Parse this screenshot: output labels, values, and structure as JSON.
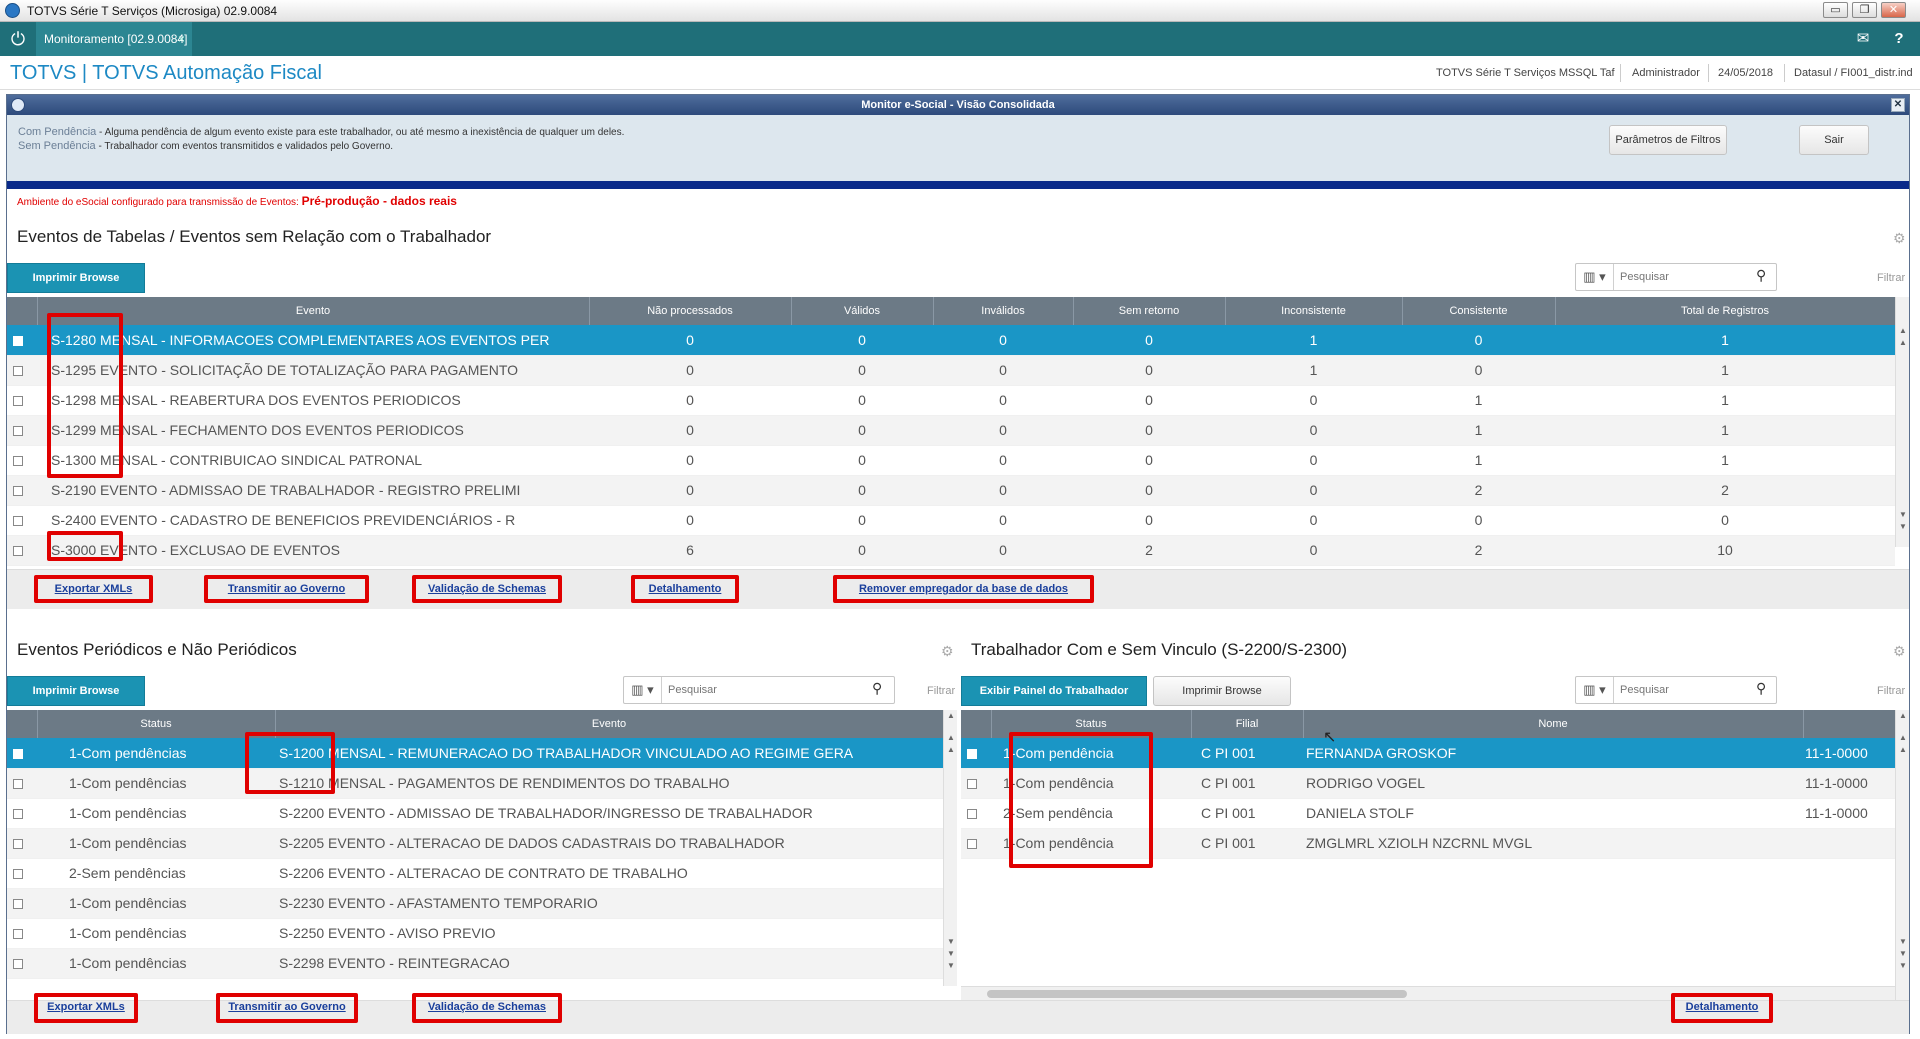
{
  "window": {
    "title": "TOTVS Série T Serviços (Microsiga) 02.9.0084",
    "min": "▭",
    "restore": "❐",
    "close": "✕"
  },
  "tab": {
    "label": "Monitoramento [02.9.0084]",
    "close": "×",
    "home_icon": "power-icon",
    "mail_icon": "✉",
    "help_icon": "?"
  },
  "header": {
    "brand": "TOTVS | TOTVS Automação Fiscal",
    "system": "TOTVS Série T Serviços MSSQL Taf",
    "user": "Administrador",
    "date": "24/05/2018",
    "env": "Datasul / FI001_distr.ind"
  },
  "monitor": {
    "title": "Monitor e-Social - Visão Consolidada",
    "close": "✕"
  },
  "legend": {
    "com_key": "Com Pendência",
    "com_text": " - Alguma pendência de algum evento existe para este trabalhador, ou até mesmo a inexistência de qualquer um deles.",
    "sem_key": "Sem Pendência",
    "sem_text": " - Trabalhador com eventos transmitidos e validados pelo Governo.",
    "params_button": "Parâmetros de Filtros",
    "exit_button": "Sair"
  },
  "env": {
    "label": "Ambiente do eSocial configurado para transmissão de Eventos: ",
    "value": "Pré-produção - dados reais"
  },
  "search_placeholder": "Pesquisar",
  "filter_label": "Filtrar",
  "columns_icon": "▥ ▾",
  "search_icon": "⚲",
  "gear_icon": "⚙",
  "tables": {
    "title": "Eventos de Tabelas / Eventos sem Relação com o Trabalhador",
    "print_button": "Imprimir Browse",
    "columns": [
      "Evento",
      "Não processados",
      "Válidos",
      "Inválidos",
      "Sem retorno",
      "Inconsistente",
      "Consistente",
      "Total de Registros"
    ],
    "rows": [
      {
        "code": "S-1280",
        "desc": "MENSAL - INFORMACOES COMPLEMENTARES AOS EVENTOS PER",
        "v": [
          "0",
          "0",
          "0",
          "0",
          "1",
          "0",
          "1"
        ]
      },
      {
        "code": "S-1295",
        "desc": "EVENTO - SOLICITAÇÃO DE TOTALIZAÇÃO PARA PAGAMENTO",
        "v": [
          "0",
          "0",
          "0",
          "0",
          "1",
          "0",
          "1"
        ]
      },
      {
        "code": "S-1298",
        "desc": "MENSAL - REABERTURA DOS EVENTOS PERIODICOS",
        "v": [
          "0",
          "0",
          "0",
          "0",
          "0",
          "1",
          "1"
        ]
      },
      {
        "code": "S-1299",
        "desc": "MENSAL - FECHAMENTO DOS EVENTOS PERIODICOS",
        "v": [
          "0",
          "0",
          "0",
          "0",
          "0",
          "1",
          "1"
        ]
      },
      {
        "code": "S-1300",
        "desc": "MENSAL - CONTRIBUICAO SINDICAL PATRONAL",
        "v": [
          "0",
          "0",
          "0",
          "0",
          "0",
          "1",
          "1"
        ]
      },
      {
        "code": "S-2190",
        "desc": "EVENTO - ADMISSAO DE TRABALHADOR - REGISTRO PRELIMI",
        "v": [
          "0",
          "0",
          "0",
          "0",
          "0",
          "2",
          "2"
        ]
      },
      {
        "code": "S-2400",
        "desc": "EVENTO - CADASTRO DE BENEFICIOS PREVIDENCIÁRIOS - R",
        "v": [
          "0",
          "0",
          "0",
          "0",
          "0",
          "0",
          "0"
        ]
      },
      {
        "code": "S-3000",
        "desc": "EVENTO - EXCLUSAO DE EVENTOS",
        "v": [
          "6",
          "0",
          "0",
          "2",
          "0",
          "2",
          "10"
        ]
      }
    ],
    "actions": [
      "Exportar XMLs",
      "Transmitir ao Governo",
      "Validação de Schemas",
      "Detalhamento",
      "Remover empregador da base de dados"
    ]
  },
  "periodic": {
    "title": "Eventos Periódicos e Não Periódicos",
    "print_button": "Imprimir Browse",
    "columns": [
      "Status",
      "Evento"
    ],
    "rows": [
      {
        "status": "1-Com pendências",
        "code": "S-1200",
        "desc": "MENSAL - REMUNERACAO DO TRABALHADOR VINCULADO AO REGIME GERA"
      },
      {
        "status": "1-Com pendências",
        "code": "S-1210",
        "desc": "MENSAL - PAGAMENTOS DE RENDIMENTOS DO TRABALHO"
      },
      {
        "status": "1-Com pendências",
        "code": "S-2200",
        "desc": "EVENTO - ADMISSAO DE TRABALHADOR/INGRESSO DE TRABALHADOR"
      },
      {
        "status": "1-Com pendências",
        "code": "S-2205",
        "desc": "EVENTO - ALTERACAO DE DADOS CADASTRAIS DO TRABALHADOR"
      },
      {
        "status": "2-Sem pendências",
        "code": "S-2206",
        "desc": "EVENTO - ALTERACAO DE CONTRATO DE TRABALHO"
      },
      {
        "status": "1-Com pendências",
        "code": "S-2230",
        "desc": "EVENTO - AFASTAMENTO TEMPORARIO"
      },
      {
        "status": "1-Com pendências",
        "code": "S-2250",
        "desc": "EVENTO - AVISO PREVIO"
      },
      {
        "status": "1-Com pendências",
        "code": "S-2298",
        "desc": "EVENTO - REINTEGRACAO"
      }
    ],
    "actions": [
      "Exportar XMLs",
      "Transmitir ao Governo",
      "Validação de Schemas"
    ]
  },
  "workers": {
    "title": "Trabalhador Com e Sem Vinculo (S-2200/S-2300)",
    "panel_button": "Exibir Painel do Trabalhador",
    "print_button": "Imprimir Browse",
    "columns": [
      "Status",
      "Filial",
      "Nome"
    ],
    "rows": [
      {
        "status": "1-Com pendência",
        "filial": "C PI 001",
        "nome": "FERNANDA GROSKOF",
        "extra": "11-1-0000"
      },
      {
        "status": "1-Com pendência",
        "filial": "C PI 001",
        "nome": "RODRIGO VOGEL",
        "extra": "11-1-0000"
      },
      {
        "status": "2-Sem pendência",
        "filial": "C PI 001",
        "nome": "DANIELA STOLF",
        "extra": "11-1-0000"
      },
      {
        "status": "1-Com pendência",
        "filial": "C PI 001",
        "nome": "ZMGLMRL XZIOLH NZCRNL MVGL",
        "extra": ""
      }
    ],
    "actions": [
      "Detalhamento"
    ]
  }
}
